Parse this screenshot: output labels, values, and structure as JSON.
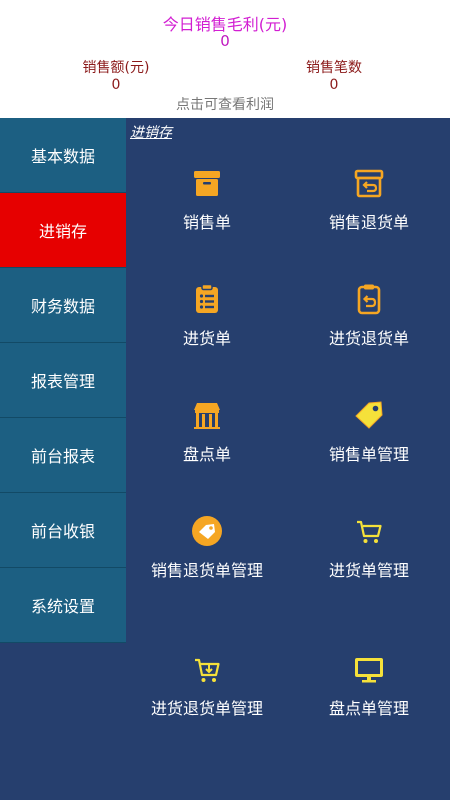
{
  "summary": {
    "profit_title": "今日销售毛利(元)",
    "profit_value": "0",
    "sales_amount_label": "销售额(元)",
    "sales_amount_value": "0",
    "sales_count_label": "销售笔数",
    "sales_count_value": "0",
    "hint": "点击可查看利润"
  },
  "sidebar": {
    "items": [
      {
        "label": "基本数据"
      },
      {
        "label": "进销存"
      },
      {
        "label": "财务数据"
      },
      {
        "label": "报表管理"
      },
      {
        "label": "前台报表"
      },
      {
        "label": "前台收银"
      },
      {
        "label": "系统设置"
      }
    ],
    "active_index": 1
  },
  "main": {
    "section_title": "进销存",
    "tiles": [
      {
        "label": "销售单",
        "icon": "box-icon"
      },
      {
        "label": "销售退货单",
        "icon": "box-return-icon"
      },
      {
        "label": "进货单",
        "icon": "clipboard-list-icon"
      },
      {
        "label": "进货退货单",
        "icon": "clipboard-return-icon"
      },
      {
        "label": "盘点单",
        "icon": "shop-icon"
      },
      {
        "label": "销售单管理",
        "icon": "tag-icon"
      },
      {
        "label": "销售退货单管理",
        "icon": "tag-circle-icon"
      },
      {
        "label": "进货单管理",
        "icon": "cart-icon"
      },
      {
        "label": "进货退货单管理",
        "icon": "cart-return-icon"
      },
      {
        "label": "盘点单管理",
        "icon": "monitor-icon"
      }
    ]
  },
  "colors": {
    "accent_icon": "#f5a623",
    "panel_bg": "#263f6e",
    "sidebar_item_bg": "#1c5f82",
    "sidebar_active_bg": "#e60000",
    "profit_text": "#d21ed2",
    "stat_text": "#8b1a1a"
  }
}
